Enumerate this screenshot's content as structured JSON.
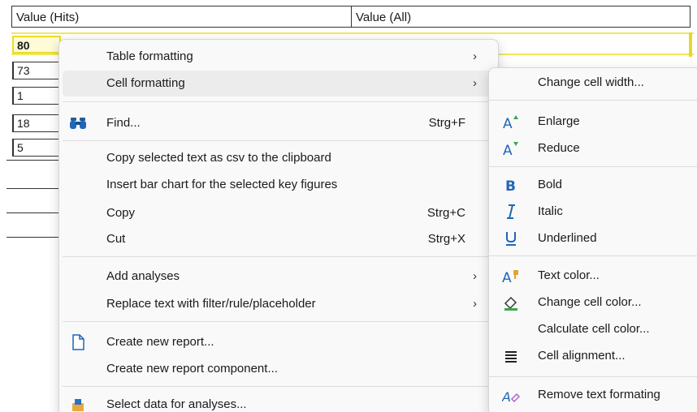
{
  "table": {
    "col1_header": "Value (Hits)",
    "col2_header": "Value (All)",
    "rows": [
      "80",
      "73",
      "1",
      "18",
      "5"
    ]
  },
  "context_menu": {
    "table_formatting": "Table formatting",
    "cell_formatting": "Cell formatting",
    "find": "Find...",
    "find_shortcut": "Strg+F",
    "copy_csv": "Copy selected text as csv to the clipboard",
    "insert_bar_chart": "Insert bar chart for the selected key figures",
    "copy": "Copy",
    "copy_shortcut": "Strg+C",
    "cut": "Cut",
    "cut_shortcut": "Strg+X",
    "add_analyses": "Add analyses",
    "replace_text": "Replace text with filter/rule/placeholder",
    "create_report": "Create new report...",
    "create_component": "Create new report component...",
    "select_data": "Select data for analyses...",
    "submenu_arrow": "›"
  },
  "cell_submenu": {
    "change_width": "Change cell width...",
    "enlarge": "Enlarge",
    "reduce": "Reduce",
    "bold": "Bold",
    "italic": "Italic",
    "underlined": "Underlined",
    "text_color": "Text color...",
    "change_cell_color": "Change cell color...",
    "calculate_cell_color": "Calculate cell color...",
    "cell_alignment": "Cell alignment...",
    "remove_formatting": "Remove text formating"
  },
  "icons": {
    "find": "binoculars-icon",
    "create_report": "new-document-icon",
    "select_data": "data-select-icon",
    "enlarge": "font-enlarge-icon",
    "reduce": "font-reduce-icon",
    "bold": "bold-icon",
    "italic": "italic-icon",
    "underlined": "underline-icon",
    "text_color": "text-color-icon",
    "change_cell_color": "fill-color-icon",
    "cell_alignment": "align-icon",
    "remove_formatting": "clear-formatting-icon"
  },
  "colors": {
    "selection_fill": "#fefbd6",
    "selection_border": "#eadc2a",
    "icon_blue": "#1f67b8",
    "menu_highlight": "#ececec"
  }
}
